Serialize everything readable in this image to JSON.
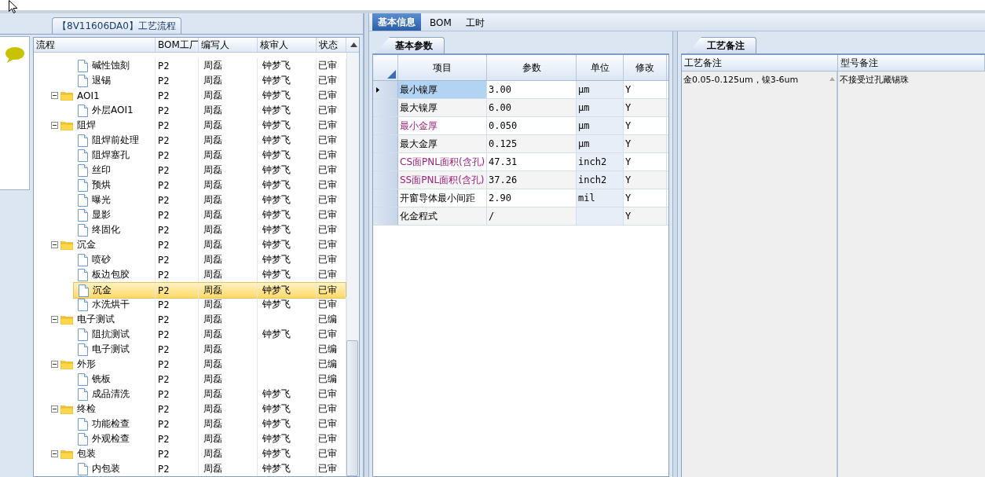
{
  "left_panel": {
    "title": "【8V11606DA0】工艺流程",
    "tree": {
      "columns": [
        "流程",
        "BOM工厂",
        "编写人",
        "核审人",
        "状态"
      ],
      "rows": [
        {
          "kind": "step",
          "name": "碱性蚀刻",
          "factory": "P2",
          "writer": "周磊",
          "reviewer": "钟梦飞",
          "status": "已审",
          "selected": false
        },
        {
          "kind": "step",
          "name": "退锡",
          "factory": "P2",
          "writer": "周磊",
          "reviewer": "钟梦飞",
          "status": "已审",
          "selected": false
        },
        {
          "kind": "group",
          "name": "AOI1",
          "factory": "P2",
          "writer": "周磊",
          "reviewer": "钟梦飞",
          "status": "已审",
          "selected": false,
          "expanded": true,
          "children": [
            {
              "kind": "step",
              "name": "外层AOI1",
              "factory": "P2",
              "writer": "周磊",
              "reviewer": "钟梦飞",
              "status": "已审",
              "selected": false
            }
          ]
        },
        {
          "kind": "group",
          "name": "阻焊",
          "factory": "P2",
          "writer": "周磊",
          "reviewer": "钟梦飞",
          "status": "已审",
          "selected": false,
          "expanded": true,
          "children": [
            {
              "kind": "step",
              "name": "阻焊前处理",
              "factory": "P2",
              "writer": "周磊",
              "reviewer": "钟梦飞",
              "status": "已审",
              "selected": false
            },
            {
              "kind": "step",
              "name": "阻焊塞孔",
              "factory": "P2",
              "writer": "周磊",
              "reviewer": "钟梦飞",
              "status": "已审",
              "selected": false
            },
            {
              "kind": "step",
              "name": "丝印",
              "factory": "P2",
              "writer": "周磊",
              "reviewer": "钟梦飞",
              "status": "已审",
              "selected": false
            },
            {
              "kind": "step",
              "name": "预烘",
              "factory": "P2",
              "writer": "周磊",
              "reviewer": "钟梦飞",
              "status": "已审",
              "selected": false
            },
            {
              "kind": "step",
              "name": "曝光",
              "factory": "P2",
              "writer": "周磊",
              "reviewer": "钟梦飞",
              "status": "已审",
              "selected": false
            },
            {
              "kind": "step",
              "name": "显影",
              "factory": "P2",
              "writer": "周磊",
              "reviewer": "钟梦飞",
              "status": "已审",
              "selected": false
            },
            {
              "kind": "step",
              "name": "终固化",
              "factory": "P2",
              "writer": "周磊",
              "reviewer": "钟梦飞",
              "status": "已审",
              "selected": false
            }
          ]
        },
        {
          "kind": "group",
          "name": "沉金",
          "factory": "P2",
          "writer": "周磊",
          "reviewer": "钟梦飞",
          "status": "已审",
          "selected": false,
          "expanded": true,
          "children": [
            {
              "kind": "step",
              "name": "喷砂",
              "factory": "P2",
              "writer": "周磊",
              "reviewer": "钟梦飞",
              "status": "已审",
              "selected": false
            },
            {
              "kind": "step",
              "name": "板边包胶",
              "factory": "P2",
              "writer": "周磊",
              "reviewer": "钟梦飞",
              "status": "已审",
              "selected": false
            },
            {
              "kind": "step",
              "name": "沉金",
              "factory": "P2",
              "writer": "周磊",
              "reviewer": "钟梦飞",
              "status": "已审",
              "selected": true
            },
            {
              "kind": "step",
              "name": "水洗烘干",
              "factory": "P2",
              "writer": "周磊",
              "reviewer": "钟梦飞",
              "status": "已审",
              "selected": false
            }
          ]
        },
        {
          "kind": "group",
          "name": "电子测试",
          "factory": "P2",
          "writer": "周磊",
          "status": "已编",
          "selected": false,
          "expanded": true,
          "children": [
            {
              "kind": "step",
              "name": "阻抗测试",
              "factory": "P2",
              "writer": "周磊",
              "reviewer": "钟梦飞",
              "status": "已审",
              "selected": false
            },
            {
              "kind": "step",
              "name": "电子测试",
              "factory": "P2",
              "writer": "周磊",
              "status": "已编",
              "selected": false
            }
          ]
        },
        {
          "kind": "group",
          "name": "外形",
          "factory": "P2",
          "writer": "周磊",
          "status": "已编",
          "selected": false,
          "expanded": true,
          "children": [
            {
              "kind": "step",
              "name": "铣板",
              "factory": "P2",
              "writer": "周磊",
              "status": "已编",
              "selected": false
            },
            {
              "kind": "step",
              "name": "成品清洗",
              "factory": "P2",
              "writer": "周磊",
              "reviewer": "钟梦飞",
              "status": "已审",
              "selected": false
            }
          ]
        },
        {
          "kind": "group",
          "name": "终检",
          "factory": "P2",
          "writer": "周磊",
          "reviewer": "钟梦飞",
          "status": "已审",
          "selected": false,
          "expanded": true,
          "children": [
            {
              "kind": "step",
              "name": "功能检查",
              "factory": "P2",
              "writer": "周磊",
              "reviewer": "钟梦飞",
              "status": "已审",
              "selected": false
            },
            {
              "kind": "step",
              "name": "外观检查",
              "factory": "P2",
              "writer": "周磊",
              "reviewer": "钟梦飞",
              "status": "已审",
              "selected": false
            }
          ]
        },
        {
          "kind": "group",
          "name": "包装",
          "factory": "P2",
          "writer": "周磊",
          "reviewer": "钟梦飞",
          "status": "已审",
          "selected": false,
          "expanded": true,
          "children": [
            {
              "kind": "step",
              "name": "内包装",
              "factory": "P2",
              "writer": "周磊",
              "reviewer": "钟梦飞",
              "status": "已审",
              "selected": false
            }
          ]
        }
      ]
    }
  },
  "tabs": [
    {
      "label": "基本信息",
      "selected": true
    },
    {
      "label": "BOM",
      "selected": false
    },
    {
      "label": "工时",
      "selected": false
    }
  ],
  "params": {
    "title": "基本参数",
    "columns": [
      "项目",
      "参数",
      "单位",
      "修改"
    ],
    "rows": [
      {
        "item": "最小镍厚",
        "value": "3.00",
        "unit": "μm",
        "edit": "Y",
        "flagged": false,
        "selected": true
      },
      {
        "item": "最大镍厚",
        "value": "6.00",
        "unit": "μm",
        "edit": "Y",
        "flagged": false,
        "selected": false
      },
      {
        "item": "最小金厚",
        "value": "0.050",
        "unit": "μm",
        "edit": "Y",
        "flagged": true,
        "selected": false
      },
      {
        "item": "最大金厚",
        "value": "0.125",
        "unit": "μm",
        "edit": "Y",
        "flagged": false,
        "selected": false
      },
      {
        "item": "CS面PNL面积(含孔)",
        "value": "47.31",
        "unit": "inch2",
        "edit": "Y",
        "flagged": true,
        "selected": false
      },
      {
        "item": "SS面PNL面积(含孔)",
        "value": "37.26",
        "unit": "inch2",
        "edit": "Y",
        "flagged": true,
        "selected": false
      },
      {
        "item": "开窗导体最小间距",
        "value": "2.90",
        "unit": "mil",
        "edit": "Y",
        "flagged": false,
        "selected": false
      },
      {
        "item": "化金程式",
        "value": "/",
        "edit": "Y",
        "flagged": false,
        "selected": false
      }
    ]
  },
  "notes": {
    "title": "工艺备注",
    "columns": [
      "工艺备注",
      "型号备注"
    ],
    "process_note": "金0.05-0.125um，镍3-6um",
    "model_note": "不接受过孔藏锡珠"
  }
}
